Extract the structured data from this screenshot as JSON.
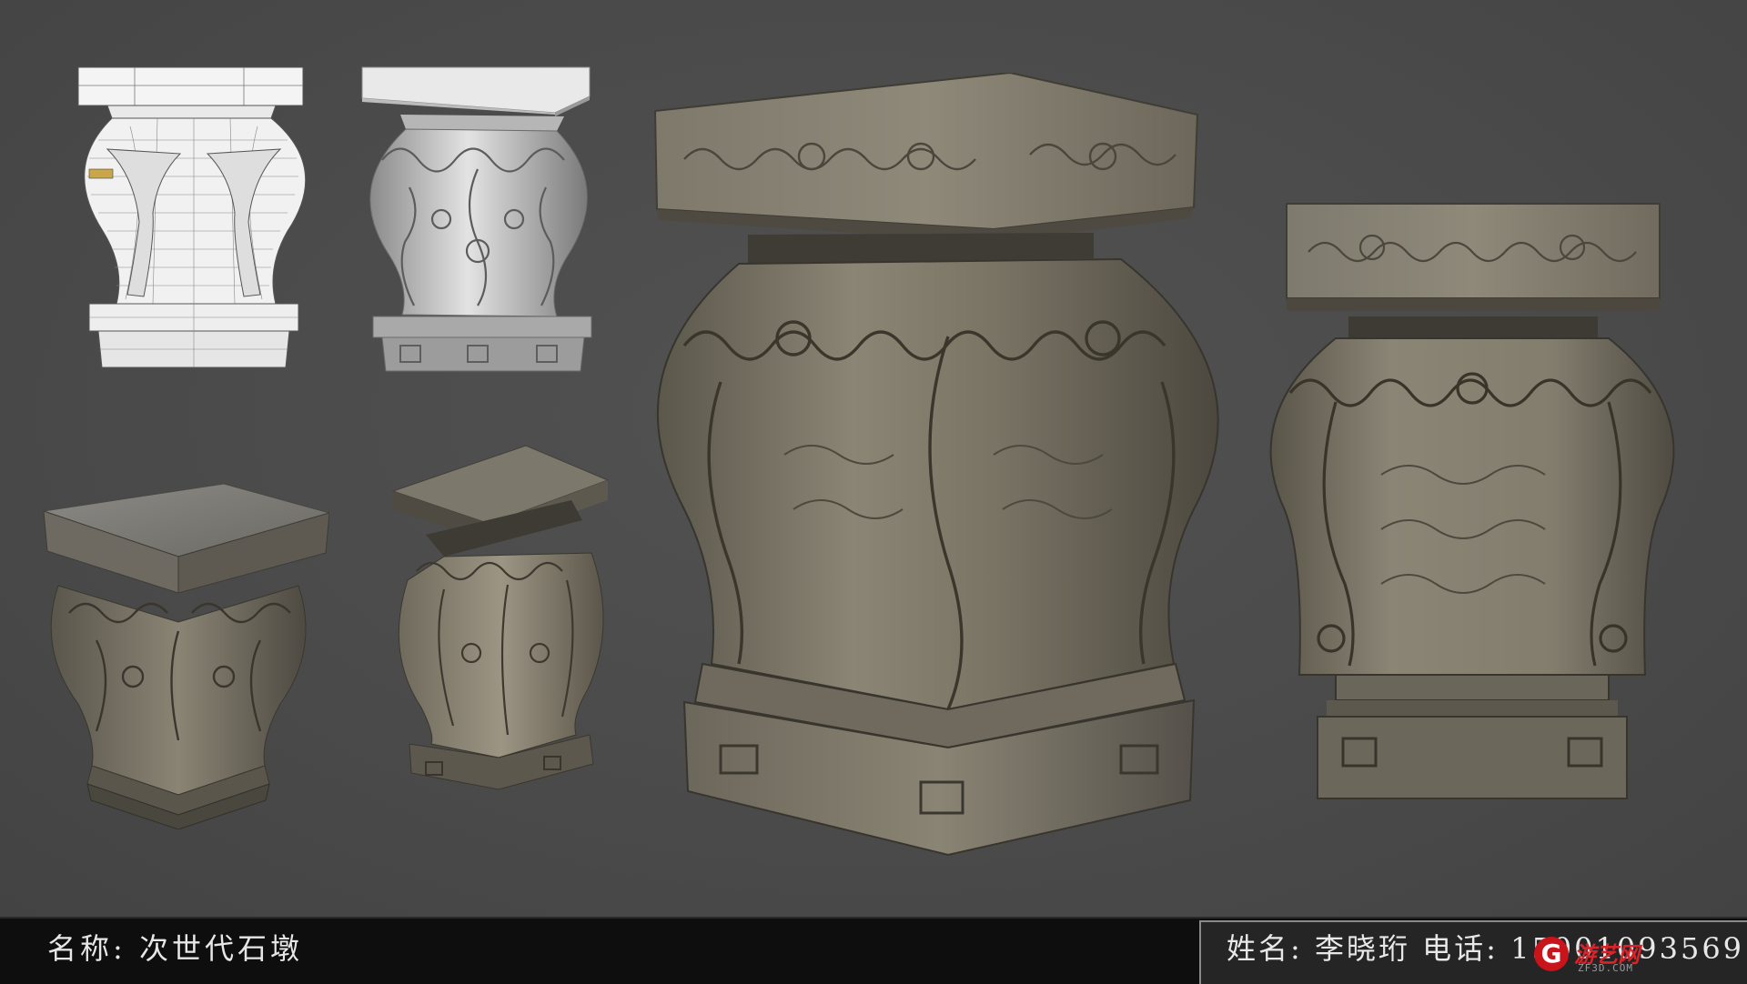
{
  "title": {
    "name_label": "名称: 次世代石墩"
  },
  "author": {
    "label": "姓名: 李晓珩  电话: 15001093569"
  },
  "watermark": {
    "logo_letter": "G",
    "brand": "游艺网",
    "site": "ZF3D.COM"
  },
  "views": [
    {
      "id": "wireframe-view",
      "style": "wireframe"
    },
    {
      "id": "highpoly-sculpt-view",
      "style": "sculpt"
    },
    {
      "id": "textured-topdown-view",
      "style": "textured"
    },
    {
      "id": "textured-angle-view",
      "style": "textured"
    },
    {
      "id": "textured-large-view",
      "style": "textured"
    },
    {
      "id": "textured-front-view",
      "style": "textured"
    }
  ],
  "colors": {
    "background": "#4b4b4b",
    "stone": "#7d786c",
    "stone_dark": "#3f3c35",
    "sculpt": "#b9b9b9",
    "wire_bg": "#f2f2f2",
    "bar": "#0e0e0e",
    "brand_red": "#c8141a"
  }
}
